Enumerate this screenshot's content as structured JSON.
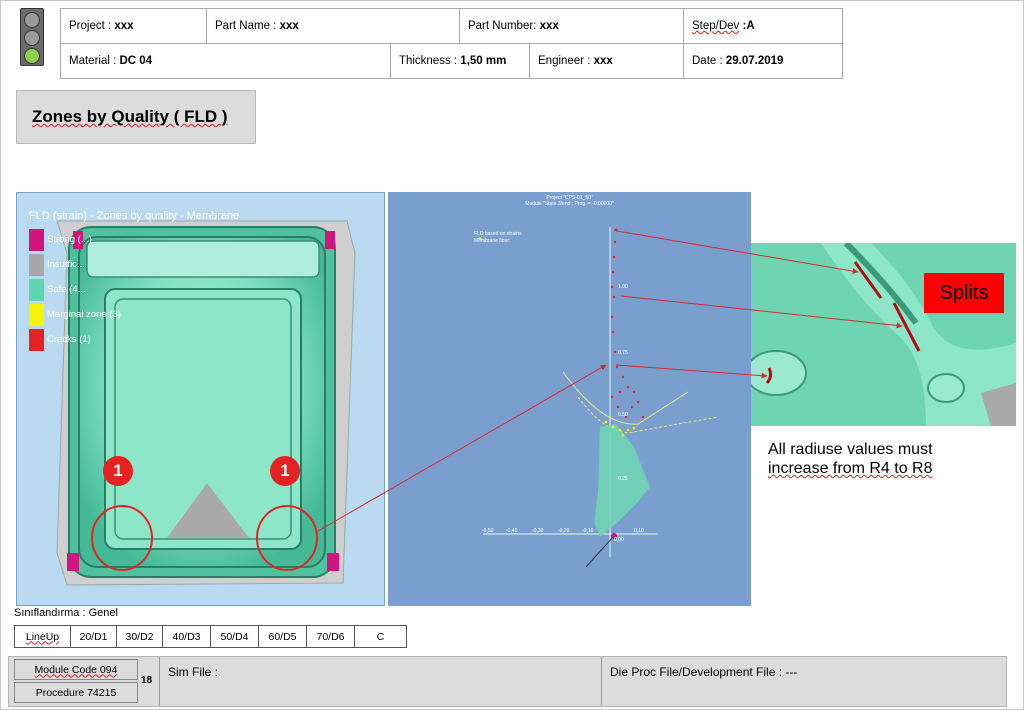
{
  "header": {
    "project_label": "Project : ",
    "project_value": "xxx",
    "part_name_label": "Part Name : ",
    "part_name_value": "xxx",
    "part_number_label": "Part Number: ",
    "part_number_value": "xxx",
    "step_dev_label": "Step/Dev",
    "step_dev_value": " :A",
    "material_label": "Material : ",
    "material_value": "DC 04",
    "thickness_label": "Thickness : ",
    "thickness_value": "1,50 mm",
    "engineer_label": "Engineer : ",
    "engineer_value": "xxx",
    "date_label": "Date : ",
    "date_value": "29.07.2019"
  },
  "title": "Zones by Quality ( FLD )",
  "left_panel": {
    "mini_header_1": "Project \"CPS-01_50\"",
    "mini_header_2": "Module \"State 3/end : Prog. = -0.00000\"",
    "caption": "FLD (strain) - Zones by quality - Membrane",
    "legend": [
      {
        "label": "Strong (...)",
        "color": "#d0167e"
      },
      {
        "label": "Insuffic...",
        "color": "#a6a6a6"
      },
      {
        "label": "Safe (4...",
        "color": "#5ed5ac"
      },
      {
        "label": "Marginal zone (3)",
        "color": "#f5f500"
      },
      {
        "label": "Cracks (1)",
        "color": "#e52222"
      }
    ],
    "markers": [
      "1",
      "1"
    ]
  },
  "mid_panel": {
    "mini_header_1": "Project \"CPS-01_50\"",
    "mini_header_2": "Module \"State 3/end : Prog. = -0.00000\"",
    "legend_1": "FLD based on strains",
    "legend_2": "Membrane fiber:",
    "y_ticks": [
      "1.00",
      "0.75",
      "0.50",
      "0.25"
    ],
    "x_ticks": [
      "-0,50",
      "-0,40",
      "-0,30",
      "-0,20",
      "-0,10",
      "0,00",
      "0,10"
    ]
  },
  "right_panel": {
    "splits_label": "Splits",
    "note_line1": "All radiuse values must",
    "note_line2": "increase from R4 to R8"
  },
  "classification": {
    "label": "Sınıflandırma : Genel",
    "cells": [
      "LineUp",
      "20/D1",
      "30/D2",
      "40/D3",
      "50/D4",
      "60/D5",
      "70/D6",
      "C"
    ]
  },
  "footer": {
    "module_code": "Module Code  094",
    "procedure": "Procedure 74215",
    "page_number": "18",
    "sim_file": "Sim File :",
    "die_proc": "Die Proc File/Development File : ---"
  },
  "colors": {
    "traffic_green": "#8fd14f",
    "traffic_grey": "#9a9a9a",
    "safe": "#5ed5ac",
    "crack": "#e52222",
    "marginal": "#f5f500",
    "strong": "#d0167e",
    "arrow": "#d62a2a"
  }
}
